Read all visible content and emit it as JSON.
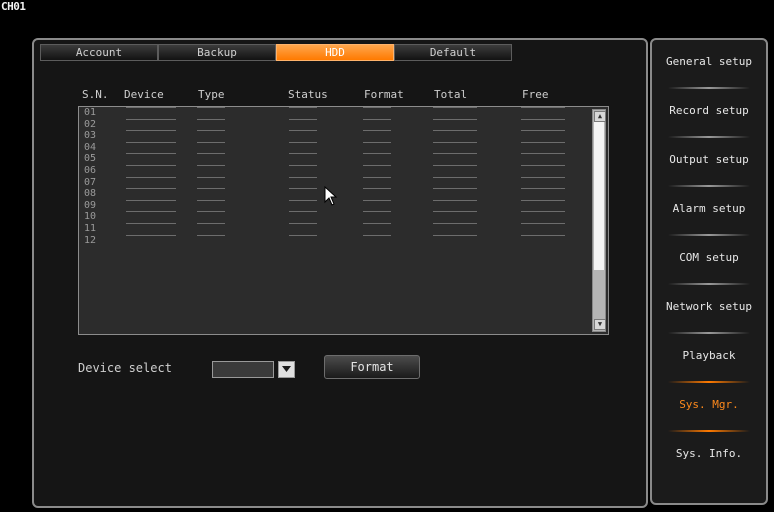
{
  "channel_label": "CH01",
  "tabs": [
    {
      "label": "Account",
      "active": false
    },
    {
      "label": "Backup",
      "active": false
    },
    {
      "label": "HDD",
      "active": true
    },
    {
      "label": "Default",
      "active": false
    }
  ],
  "columns": [
    "S.N.",
    "Device",
    "Type",
    "Status",
    "Format",
    "Total",
    "Free"
  ],
  "rows": [
    "01",
    "02",
    "03",
    "04",
    "05",
    "06",
    "07",
    "08",
    "09",
    "10",
    "11",
    "12"
  ],
  "empty_cell": "------",
  "device_select": {
    "label": "Device select",
    "value": ""
  },
  "format_button": "Format",
  "menu": [
    {
      "label": "General setup",
      "active": false
    },
    {
      "label": "Record setup",
      "active": false
    },
    {
      "label": "Output setup",
      "active": false
    },
    {
      "label": "Alarm setup",
      "active": false
    },
    {
      "label": "COM setup",
      "active": false
    },
    {
      "label": "Network setup",
      "active": false
    },
    {
      "label": "Playback",
      "active": false
    },
    {
      "label": "Sys. Mgr.",
      "active": true
    },
    {
      "label": "Sys. Info.",
      "active": false
    }
  ],
  "colors": {
    "accent": "#ff7a00",
    "active_menu_text": "#ff8a1c",
    "background": "#000000",
    "panel": "#151515"
  }
}
